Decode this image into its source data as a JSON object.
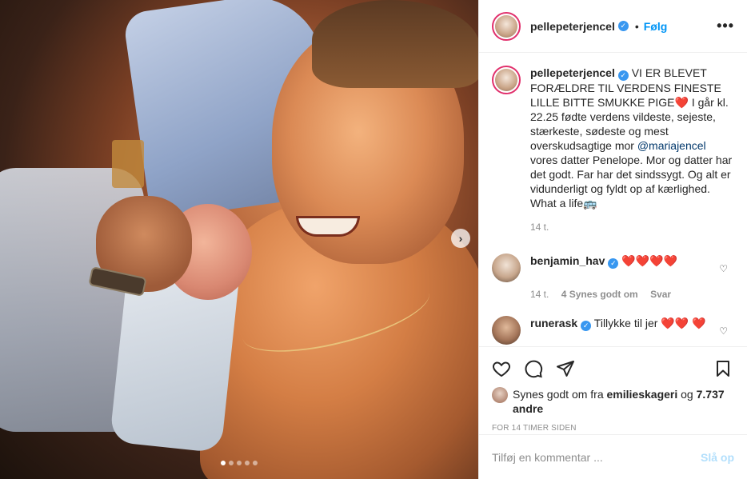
{
  "author": {
    "username": "pellepeterjencel",
    "verified_icon": "verified-badge-icon",
    "follow_dot": "•",
    "follow_label": "Følg",
    "more_label": "•••"
  },
  "media": {
    "next_arrow": "›",
    "dots_count": 5,
    "active_dot": 0
  },
  "caption": {
    "username": "pellepeterjencel",
    "text_part1": " VI ER BLEVET FORÆLDRE TIL VERDENS FINESTE LILLE BITTE SMUKKE PIGE❤️ I går kl. 22.25 fødte verdens vildeste, sejeste, stærkeste, sødeste og mest overskudsagtige mor ",
    "mention": "@mariajencel",
    "text_part2": " vores datter Penelope. Mor og datter har det godt. Far har det sindssygt. Og alt er vidunderligt og fyldt op af kærlighed. What a life🚌",
    "time": "14 t."
  },
  "comments": [
    {
      "username": "benjamin_hav",
      "text": "❤️❤️❤️❤️",
      "time": "14 t.",
      "likes": "4 Synes godt om",
      "reply": "Svar"
    },
    {
      "username": "runerask",
      "text": "Tillykke til jer ❤️❤️ ❤️"
    }
  ],
  "likes": {
    "prefix": "Synes godt om fra ",
    "user": "emilieskageri",
    "middle": " og ",
    "count": "7.737 andre"
  },
  "timestamp": "FOR 14 TIMER SIDEN",
  "add_comment": {
    "placeholder": "Tilføj en kommentar ...",
    "post_label": "Slå op"
  },
  "colors": {
    "accent": "#0095f6",
    "verified": "#3897f0",
    "like_red": "#ed4956"
  }
}
